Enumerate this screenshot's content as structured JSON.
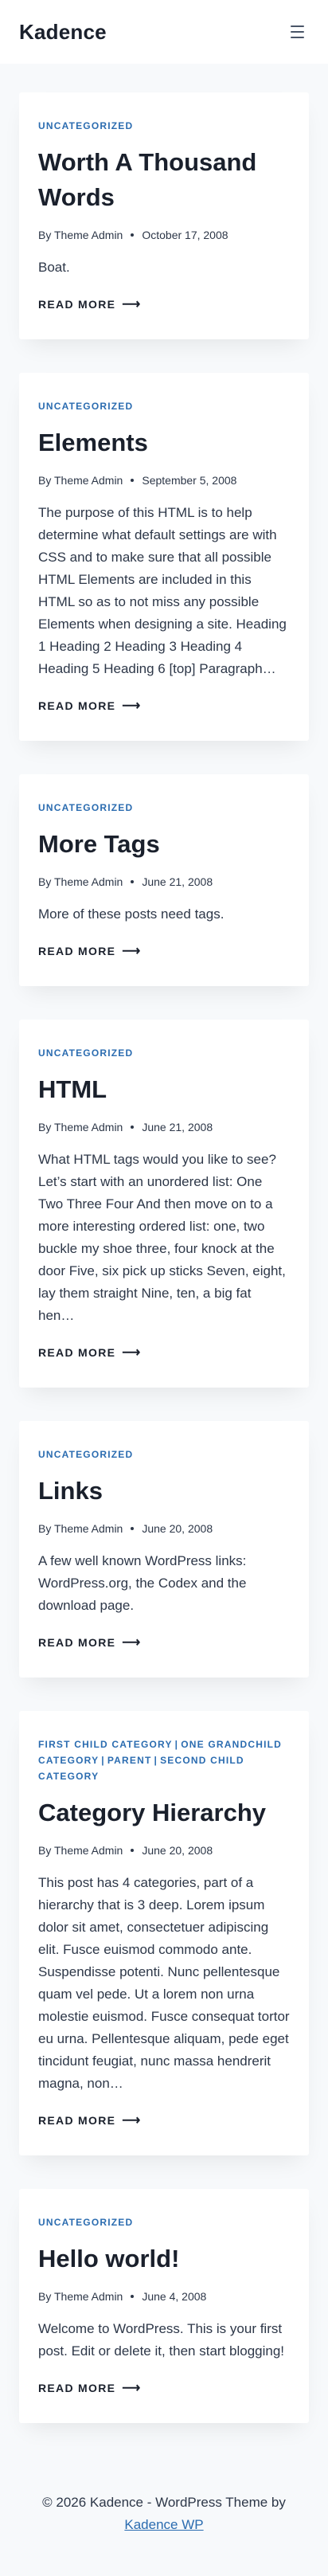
{
  "header": {
    "site_title": "Kadence",
    "menu_icon": "hamburger-icon"
  },
  "posts": [
    {
      "categories": [
        "Uncategorized"
      ],
      "title": "Worth A Thousand Words",
      "author": "By Theme Admin",
      "date": "October 17, 2008",
      "excerpt": "Boat.",
      "read_more": "Read More"
    },
    {
      "categories": [
        "Uncategorized"
      ],
      "title": "Elements",
      "author": "By Theme Admin",
      "date": "September 5, 2008",
      "excerpt": "The purpose of this HTML is to help determine what default settings are with CSS and to make sure that all possible HTML Elements are included in this HTML so as to not miss any possible Elements when designing a site. Heading 1 Heading 2 Heading 3 Heading 4 Heading 5 Heading 6 [top] Paragraph…",
      "read_more": "Read More"
    },
    {
      "categories": [
        "Uncategorized"
      ],
      "title": "More Tags",
      "author": "By Theme Admin",
      "date": "June 21, 2008",
      "excerpt": "More of these posts need tags.",
      "read_more": "Read More"
    },
    {
      "categories": [
        "Uncategorized"
      ],
      "title": "HTML",
      "author": "By Theme Admin",
      "date": "June 21, 2008",
      "excerpt": "What HTML tags would you like to see? Let’s start with an unordered list: One Two Three Four And then move on to a more interesting ordered list: one, two buckle my shoe three, four knock at the door Five, six pick up sticks Seven, eight, lay them straight Nine, ten, a big fat hen…",
      "read_more": "Read More"
    },
    {
      "categories": [
        "Uncategorized"
      ],
      "title": "Links",
      "author": "By Theme Admin",
      "date": "June 20, 2008",
      "excerpt": "A few well known WordPress links: WordPress.org, the Codex and the download page.",
      "read_more": "Read More"
    },
    {
      "categories": [
        "First Child Category",
        "One Grandchild Category",
        "Parent",
        "Second Child Category"
      ],
      "title": "Category Hierarchy",
      "author": "By Theme Admin",
      "date": "June 20, 2008",
      "excerpt": "This post has 4 categories, part of a hierarchy that is 3 deep. Lorem ipsum dolor sit amet, consectetuer adipiscing elit. Fusce euismod commodo ante. Suspendisse potenti. Nunc pellentesque quam vel pede. Ut a lorem non urna molestie euismod. Fusce consequat tortor eu urna. Pellentesque aliquam, pede eget tincidunt feugiat, nunc massa hendrerit magna, non…",
      "read_more": "Read More"
    },
    {
      "categories": [
        "Uncategorized"
      ],
      "title": "Hello world!",
      "author": "By Theme Admin",
      "date": "June 4, 2008",
      "excerpt": "Welcome to WordPress. This is your first post. Edit or delete it, then start blogging!",
      "read_more": "Read More"
    }
  ],
  "category_separator": "|",
  "read_more_arrow": "⟶",
  "footer": {
    "text": "© 2026 Kadence - WordPress Theme by",
    "link": "Kadence WP"
  },
  "colors": {
    "accent": "#2b6cb0",
    "text": "#1a202c",
    "background": "#f7f9fb"
  }
}
